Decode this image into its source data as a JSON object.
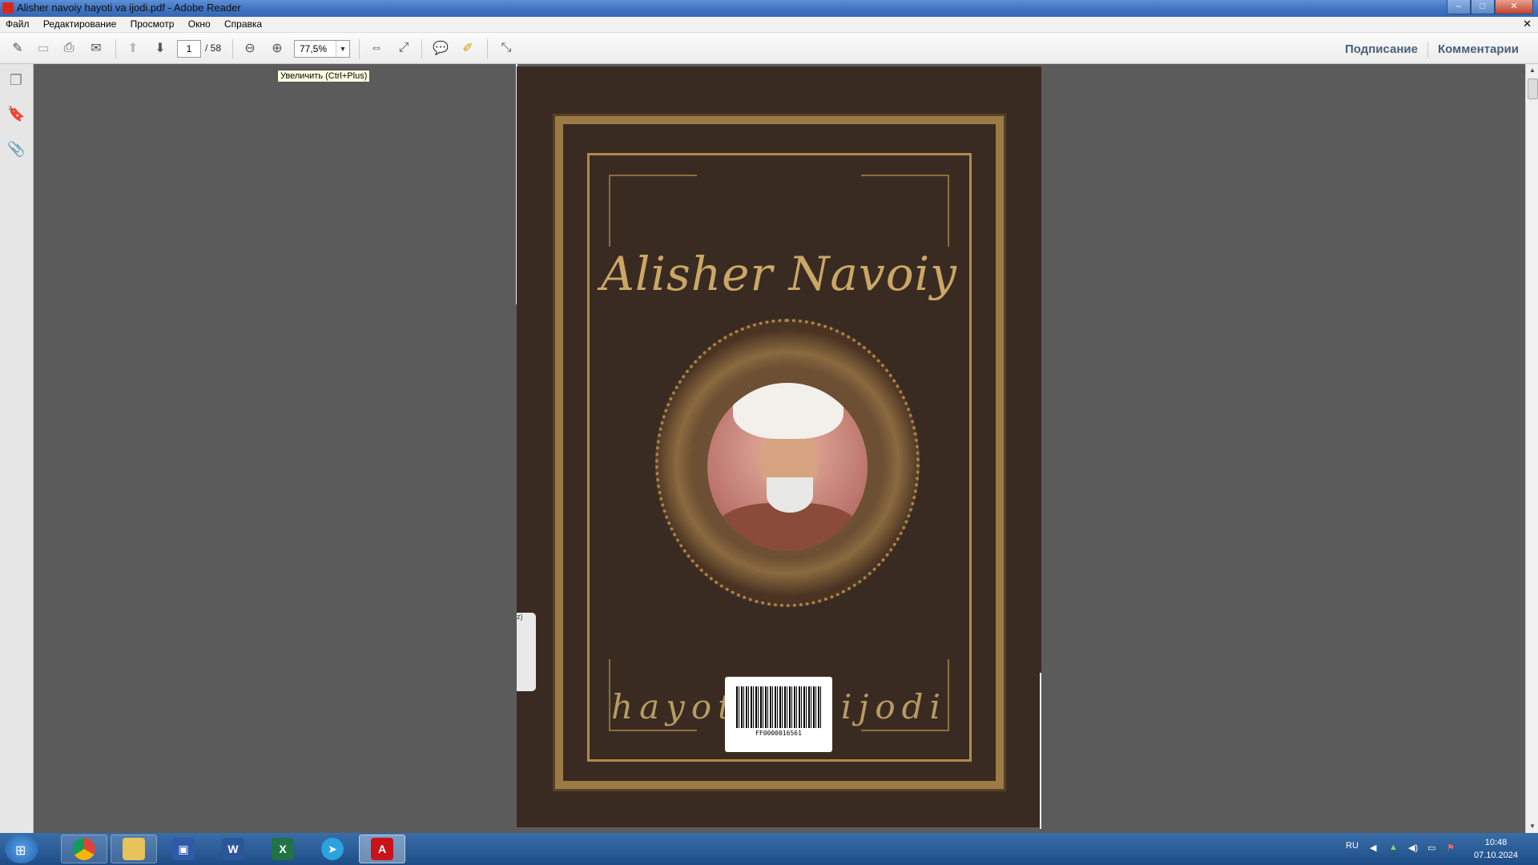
{
  "window": {
    "title": "Alisher navoiy hayoti va ijodi.pdf - Adobe Reader",
    "controls": {
      "minimize": "–",
      "maximize": "□",
      "close": "✕"
    }
  },
  "menu": {
    "items": [
      "Файл",
      "Редактирование",
      "Просмотр",
      "Окно",
      "Справка"
    ],
    "close_doc": "✕"
  },
  "toolbar": {
    "current_page": "1",
    "total_pages": "/ 58",
    "zoom": "77,5%",
    "sign_label": "Подписание",
    "comment_label": "Комментарии",
    "tooltip": "Увеличить (Ctrl+Plus)"
  },
  "document": {
    "cover_title": "Alisher Navoiy",
    "cover_subtitle": "hayoti va ijodi",
    "barcode_text": "FF0000016561",
    "sticker_text": "z)"
  },
  "taskbar": {
    "apps": [
      "Chrome",
      "Explorer",
      "Save",
      "Word",
      "Excel",
      "Telegram",
      "Adobe Reader"
    ],
    "language": "RU",
    "time": "10:48",
    "date": "07.10.2024"
  },
  "colors": {
    "title_bar": "#3f73bf",
    "cover_bg": "#3a2b22",
    "cover_gold": "#caa766",
    "accent_links": "#4a5f79"
  }
}
